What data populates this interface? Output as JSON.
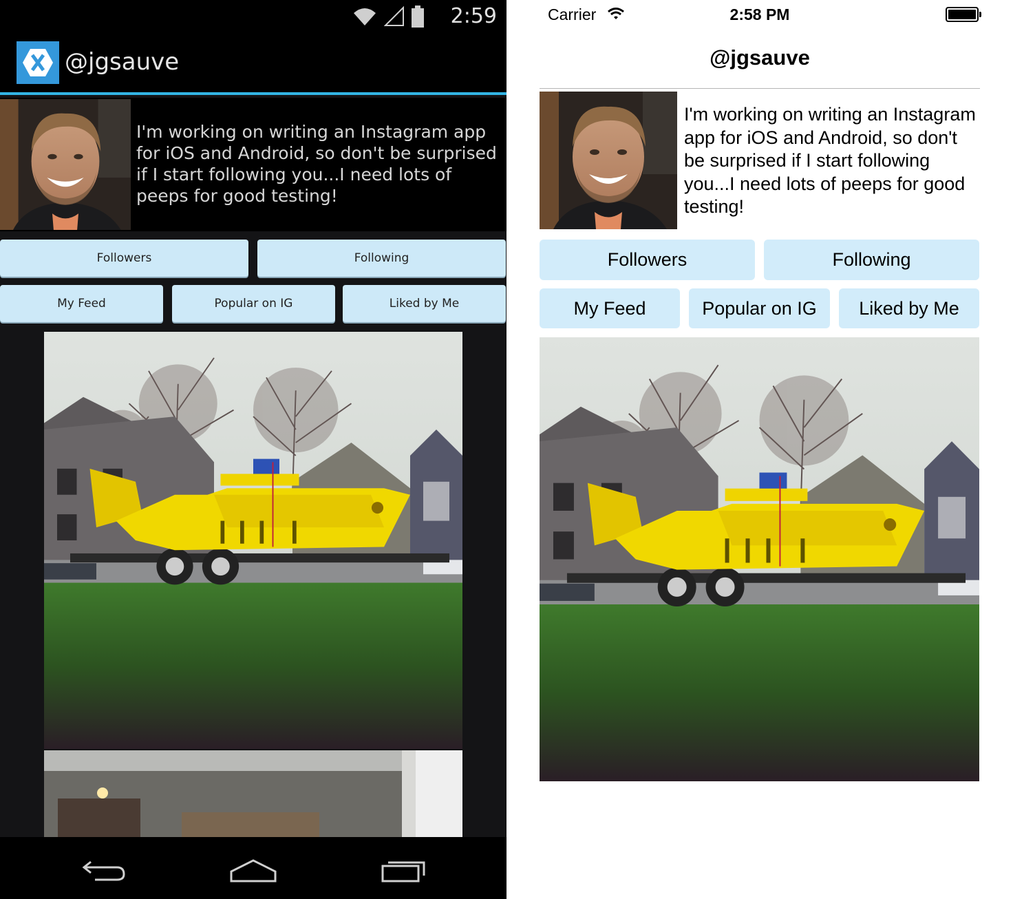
{
  "android": {
    "status_time": "2:59",
    "actionbar_title": "@jgsauve",
    "bio": "I'm working on writing an Instagram app for iOS and Android, so don't be surprised if I start following you...I need lots of peeps for good testing!",
    "buttons": {
      "followers": "Followers",
      "following": "Following",
      "my_feed": "My Feed",
      "popular": "Popular on IG",
      "liked": "Liked by Me"
    },
    "accent_color": "#33b5e5",
    "button_color": "#cde9f8"
  },
  "ios": {
    "carrier": "Carrier",
    "status_time": "2:58 PM",
    "nav_title": "@jgsauve",
    "bio": "I'm working on writing an Instagram app for iOS and Android, so don't be surprised if I start following you...I need lots of peeps for good testing!",
    "buttons": {
      "followers": "Followers",
      "following": "Following",
      "my_feed": "My Feed",
      "popular": "Popular on IG",
      "liked": "Liked by Me"
    },
    "button_color": "#d2ecfa"
  },
  "icons": [
    "wifi-icon",
    "signal-icon",
    "battery-icon",
    "xamarin-logo-icon",
    "back-icon",
    "home-icon",
    "recents-icon"
  ]
}
